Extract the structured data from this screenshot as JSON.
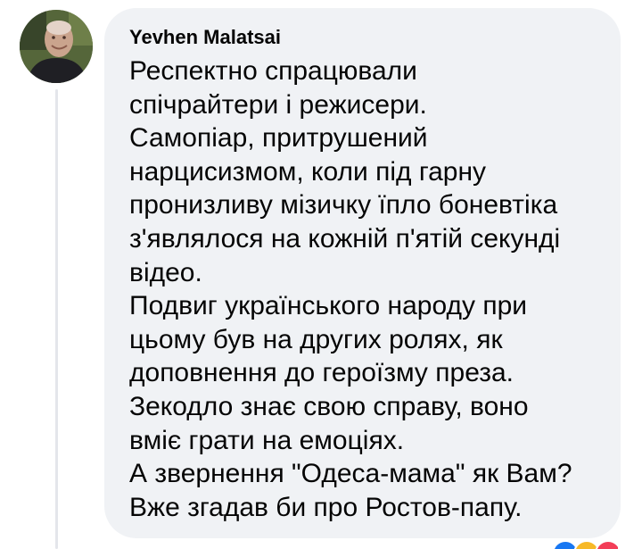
{
  "comment": {
    "author": "Yevhen Malatsai",
    "lines": [
      "Респектно спрацювали",
      "спічрайтери і режисери.",
      "Самопіар, притрушений",
      "нарцисизмом, коли під гарну",
      "пронизливу мізичку їпло боневтіка",
      "з'являлося на кожній п'ятій секунді",
      "відео.",
      "Подвиг українського народу при",
      "цьому був на других ролях, як",
      "доповнення до героїзму преза.",
      "Зекодло знає свою справу, воно",
      "вміє грати на емоціях.",
      "А звернення \"Одеса-мама\" як Вам?",
      "Вже згадав би про Ростов-папу."
    ]
  },
  "colors": {
    "bubble_bg": "#f0f2f5",
    "text": "#050505",
    "thread_line": "#e4e6eb"
  },
  "icons": {
    "reactions": [
      "like-icon",
      "haha-icon",
      "love-icon"
    ]
  }
}
